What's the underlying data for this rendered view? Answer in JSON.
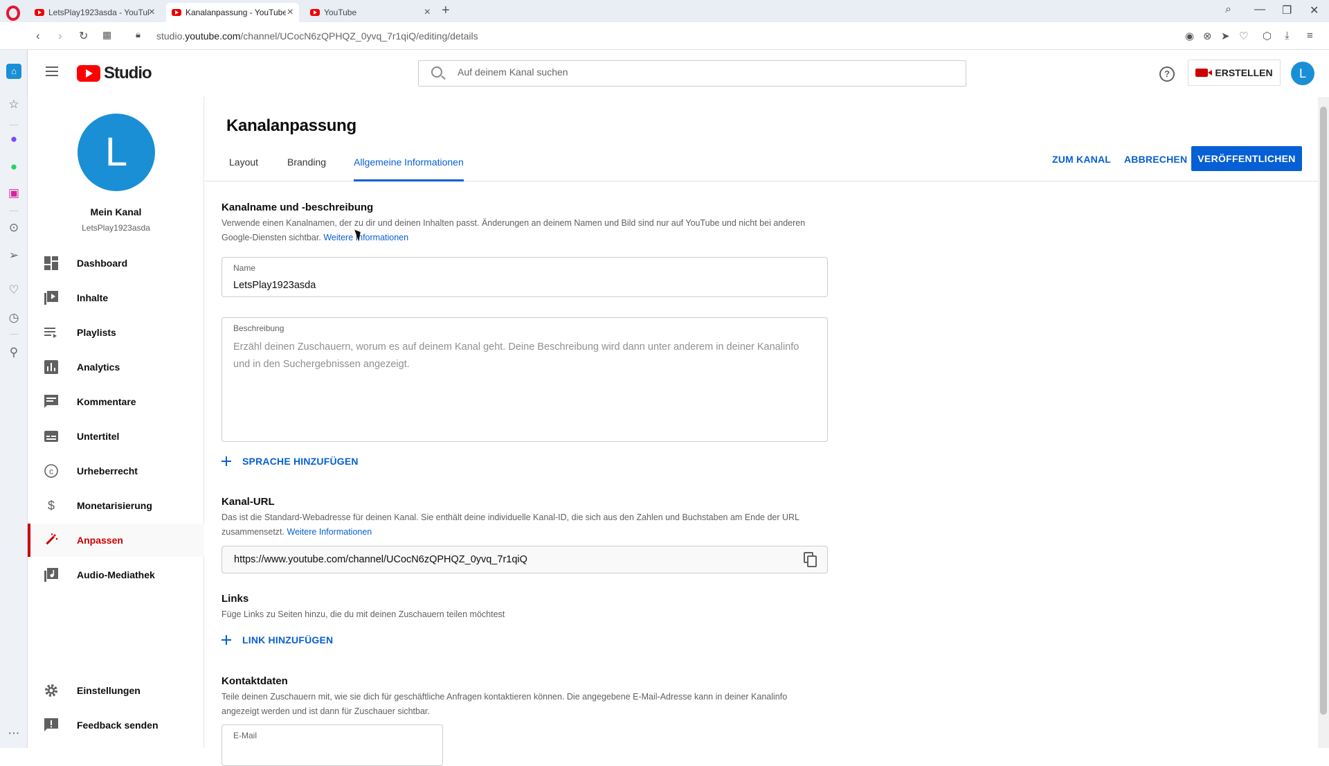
{
  "browser": {
    "tabs": [
      {
        "label": "LetsPlay1923asda - YouTube"
      },
      {
        "label": "Kanalanpassung - YouTube"
      },
      {
        "label": "YouTube"
      }
    ],
    "url_prefix": "studio.",
    "url_domain": "youtube.com",
    "url_path": "/channel/UCocN6zQPHQZ_0yvq_7r1qiQ/editing/details"
  },
  "header": {
    "logo_text": "Studio",
    "search_placeholder": "Auf deinem Kanal suchen",
    "help_symbol": "?",
    "create_label": "ERSTELLEN",
    "avatar_letter": "L"
  },
  "sidebar": {
    "avatar_letter": "L",
    "channel_title": "Mein Kanal",
    "channel_handle": "LetsPlay1923asda",
    "items": [
      {
        "label": "Dashboard",
        "icon": "dashboard-icon"
      },
      {
        "label": "Inhalte",
        "icon": "content-icon"
      },
      {
        "label": "Playlists",
        "icon": "playlists-icon"
      },
      {
        "label": "Analytics",
        "icon": "analytics-icon"
      },
      {
        "label": "Kommentare",
        "icon": "comments-icon"
      },
      {
        "label": "Untertitel",
        "icon": "subtitles-icon"
      },
      {
        "label": "Urheberrecht",
        "icon": "copyright-icon"
      },
      {
        "label": "Monetarisierung",
        "icon": "dollar-icon"
      },
      {
        "label": "Anpassen",
        "icon": "customize-icon",
        "active": true
      },
      {
        "label": "Audio-Mediathek",
        "icon": "audio-library-icon"
      }
    ],
    "bottom_items": [
      {
        "label": "Einstellungen",
        "icon": "settings-icon"
      },
      {
        "label": "Feedback senden",
        "icon": "feedback-icon"
      }
    ]
  },
  "main": {
    "title": "Kanalanpassung",
    "tabs": [
      {
        "label": "Layout"
      },
      {
        "label": "Branding"
      },
      {
        "label": "Allgemeine Informationen",
        "active": true
      }
    ],
    "actions": {
      "view_channel": "ZUM KANAL",
      "cancel": "ABBRECHEN",
      "publish": "VERÖFFENTLICHEN"
    },
    "name_section": {
      "title": "Kanalname und -beschreibung",
      "desc": "Verwende einen Kanalnamen, der zu dir und deinen Inhalten passt. Änderungen an deinem Namen und Bild sind nur auf YouTube und nicht bei anderen Google-Diensten sichtbar.",
      "link": "Weitere Informationen",
      "name_label": "Name",
      "name_value": "LetsPlay1923asda",
      "description_label": "Beschreibung",
      "description_placeholder": "Erzähl deinen Zuschauern, worum es auf deinem Kanal geht. Deine Beschreibung wird dann unter anderem in deiner Kanalinfo und in den Suchergebnissen angezeigt.",
      "add_language": "SPRACHE HINZUFÜGEN"
    },
    "url_section": {
      "title": "Kanal-URL",
      "desc": "Das ist die Standard-Webadresse für deinen Kanal. Sie enthält deine individuelle Kanal-ID, die sich aus den Zahlen und Buchstaben am Ende der URL zusammensetzt.",
      "link": "Weitere Informationen",
      "url_value": "https://www.youtube.com/channel/UCocN6zQPHQZ_0yvq_7r1qiQ"
    },
    "links_section": {
      "title": "Links",
      "desc": "Füge Links zu Seiten hinzu, die du mit deinen Zuschauern teilen möchtest",
      "add_link": "LINK HINZUFÜGEN"
    },
    "contact_section": {
      "title": "Kontaktdaten",
      "desc": "Teile deinen Zuschauern mit, wie sie dich für geschäftliche Anfragen kontaktieren können. Die angegebene E-Mail-Adresse kann in deiner Kanalinfo angezeigt werden und ist dann für Zuschauer sichtbar.",
      "email_label": "E-Mail"
    }
  },
  "colors": {
    "accent_blue": "#065fd4",
    "youtube_red": "#ff0000",
    "active_red": "#cc0000",
    "avatar_blue": "#1a8fd6"
  }
}
